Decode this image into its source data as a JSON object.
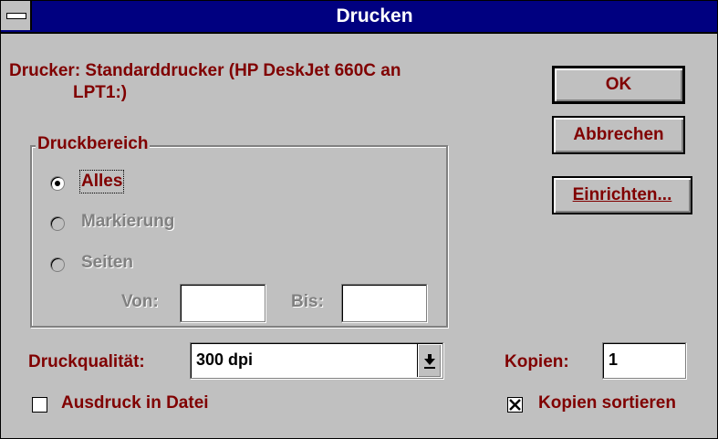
{
  "window": {
    "title": "Drucken"
  },
  "printer": {
    "line1": "Drucker: Standarddrucker (HP DeskJet 660C an",
    "line2": "LPT1:)"
  },
  "buttons": {
    "ok": "OK",
    "cancel": "Abbrechen",
    "setup": "Einrichten..."
  },
  "print_range": {
    "legend": "Druckbereich",
    "options": [
      {
        "label": "Alles",
        "selected": true,
        "enabled": true
      },
      {
        "label": "Markierung",
        "selected": false,
        "enabled": false
      },
      {
        "label": "Seiten",
        "selected": false,
        "enabled": false
      }
    ],
    "from_label": "Von:",
    "from_value": "",
    "to_label": "Bis:",
    "to_value": ""
  },
  "quality": {
    "label": "Druckqualität:",
    "value": "300 dpi"
  },
  "copies": {
    "label": "Kopien:",
    "value": "1"
  },
  "print_to_file": {
    "label": "Ausdruck in Datei",
    "checked": false
  },
  "collate": {
    "label": "Kopien sortieren",
    "checked": true
  },
  "colors": {
    "title_bar": "#000080",
    "face": "#c0c0c0",
    "text": "#800000",
    "disabled": "#808080"
  }
}
